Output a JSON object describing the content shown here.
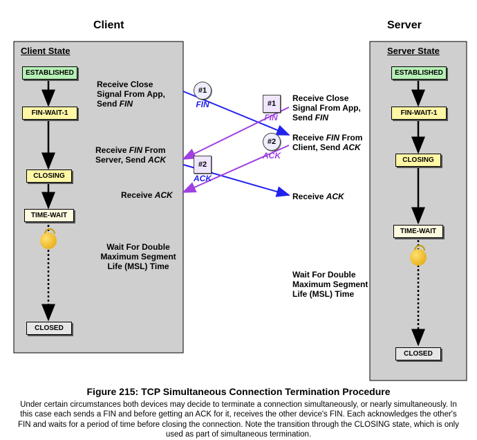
{
  "headers": {
    "client": "Client",
    "server": "Server"
  },
  "panel_titles": {
    "client": "Client State",
    "server": "Server State"
  },
  "states": {
    "client": [
      "ESTABLISHED",
      "FIN-WAIT-1",
      "CLOSING",
      "TIME-WAIT",
      "CLOSED"
    ],
    "server": [
      "ESTABLISHED",
      "FIN-WAIT-1",
      "CLOSING",
      "TIME-WAIT",
      "CLOSED"
    ]
  },
  "events": {
    "client": {
      "recv_close": "Receive Close Signal From App, Send ",
      "recv_close_em": "FIN",
      "recv_fin": "Receive ",
      "recv_fin_em1": "FIN",
      "recv_fin_mid": " From Server, Send ",
      "recv_fin_em2": "ACK",
      "recv_ack": "Receive ",
      "recv_ack_em": "ACK",
      "wait": "Wait For Double Maximum Segment Life (MSL) Time"
    },
    "server": {
      "recv_close": "Receive Close Signal From App, Send ",
      "recv_close_em": "FIN",
      "recv_fin": "Receive ",
      "recv_fin_em1": "FIN",
      "recv_fin_mid": " From Client, Send ",
      "recv_fin_em2": "ACK",
      "recv_ack": "Receive ",
      "recv_ack_em": "ACK",
      "wait": "Wait For Double Maximum Segment Life (MSL) Time"
    }
  },
  "badges": {
    "one": "#1",
    "two": "#2"
  },
  "messages": {
    "fin": "FIN",
    "ack": "ACK"
  },
  "caption": {
    "title": "Figure 215: TCP Simultaneous Connection Termination Procedure",
    "body": "Under certain circumstances both devices may decide to terminate a connection simultaneously, or nearly simultaneously. In this case each sends a FIN and before getting an ACK for it, receives the other device's FIN. Each acknowledges the other's FIN and waits for a period of time before closing the connection. Note the transition through the CLOSING state, which is only used as part of simultaneous termination."
  },
  "chart_data": {
    "type": "sequence-state",
    "participants": [
      "Client",
      "Server"
    ],
    "client_states": [
      "ESTABLISHED",
      "FIN-WAIT-1",
      "CLOSING",
      "TIME-WAIT",
      "CLOSED"
    ],
    "server_states": [
      "ESTABLISHED",
      "FIN-WAIT-1",
      "CLOSING",
      "TIME-WAIT",
      "CLOSED"
    ],
    "messages": [
      {
        "id": "#1",
        "from": "Client",
        "to": "Server",
        "label": "FIN",
        "color": "#2222ee",
        "causes_server_transition": "FIN-WAIT-1 -> CLOSING"
      },
      {
        "id": "#1",
        "from": "Server",
        "to": "Client",
        "label": "FIN",
        "color": "#a040e0",
        "causes_client_transition": "FIN-WAIT-1 -> CLOSING"
      },
      {
        "id": "#2",
        "from": "Client",
        "to": "Server",
        "label": "ACK",
        "color": "#2222ee",
        "causes_server_transition": "CLOSING -> TIME-WAIT"
      },
      {
        "id": "#2",
        "from": "Server",
        "to": "Client",
        "label": "ACK",
        "color": "#a040e0",
        "causes_client_transition": "CLOSING -> TIME-WAIT"
      }
    ],
    "post_wait": {
      "label": "Wait For Double Maximum Segment Life (MSL) Time",
      "leads_to": "CLOSED"
    }
  }
}
